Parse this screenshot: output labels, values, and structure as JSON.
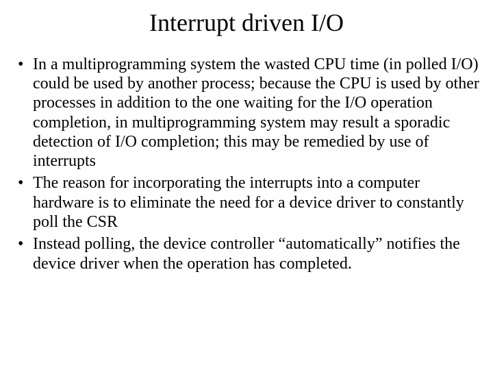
{
  "slide": {
    "title": "Interrupt driven I/O",
    "bullets": [
      "In a multiprogramming system the wasted CPU time (in polled I/O) could be used by another process; because the CPU is used by other processes in addition to the one waiting for the I/O operation completion, in multiprogramming system may result a sporadic detection of I/O completion; this may be remedied  by use of interrupts",
      "The reason for incorporating the interrupts into a computer hardware is to eliminate the need for a device driver to constantly poll the CSR",
      "Instead polling, the device controller “automatically” notifies the device driver when the operation has completed."
    ]
  }
}
